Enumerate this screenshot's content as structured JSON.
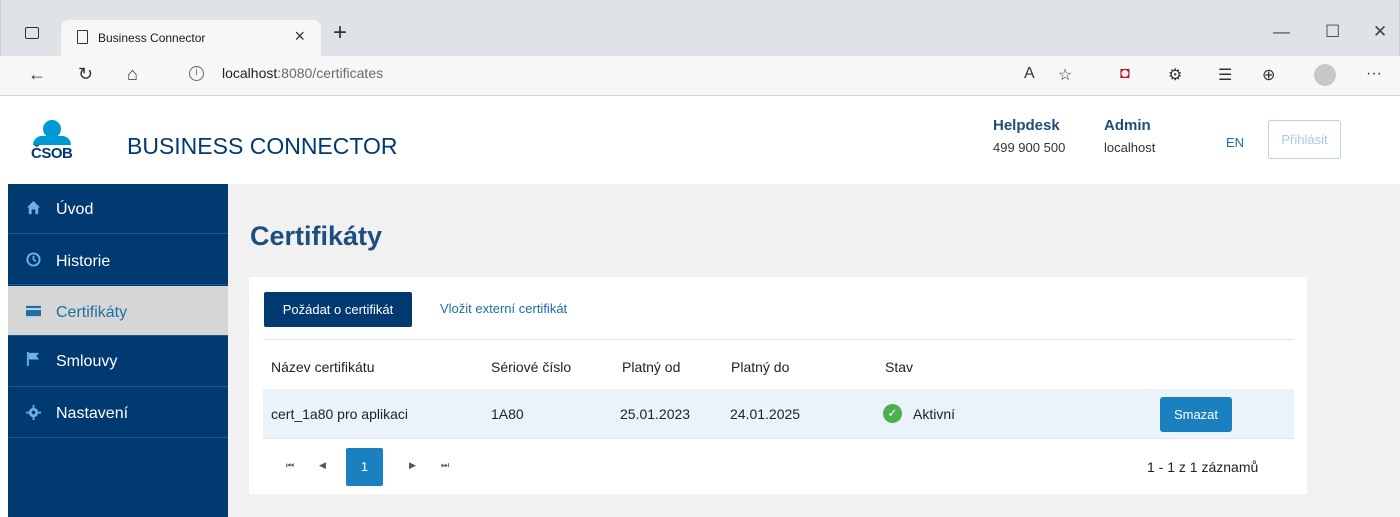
{
  "browser": {
    "tab_title": "Business Connector",
    "tab_close": "×",
    "new_tab": "+",
    "url_host": "localhost",
    "url_path": ":8080/certificates",
    "win_min": "—",
    "win_max": "☐",
    "win_close": "✕",
    "menu": "···"
  },
  "header": {
    "logo_text": "ČSOB",
    "brand": "BUSINESS CONNECTOR",
    "helpdesk_title": "Helpdesk",
    "helpdesk_phone": "499 900 500",
    "admin_title": "Admin",
    "admin_host": "localhost",
    "lang": "EN",
    "login": "Přihlásit"
  },
  "sidebar": {
    "items": [
      {
        "label": "Úvod",
        "icon": "home-icon"
      },
      {
        "label": "Historie",
        "icon": "clock-icon"
      },
      {
        "label": "Certifikáty",
        "icon": "card-icon"
      },
      {
        "label": "Smlouvy",
        "icon": "flag-icon"
      },
      {
        "label": "Nastavení",
        "icon": "gear-icon"
      }
    ],
    "active_index": 2
  },
  "main": {
    "title": "Certifikáty",
    "request_button": "Požádat o certifikát",
    "external_link": "Vložit externí certifikát",
    "columns": [
      "Název certifikátu",
      "Sériové číslo",
      "Platný od",
      "Platný do",
      "Stav"
    ],
    "rows": [
      {
        "name": "cert_1a80 pro aplikaci",
        "serial": "1A80",
        "valid_from": "25.01.2023",
        "valid_to": "24.01.2025",
        "status": "Aktivní",
        "delete": "Smazat"
      }
    ],
    "pager": {
      "first": "⏮",
      "prev": "◀",
      "current": "1",
      "next": "▶",
      "last": "⏭",
      "info": "1 - 1 z 1 záznamů"
    }
  },
  "colors": {
    "primary": "#003a70",
    "accent": "#1b80c0",
    "success": "#4caf50"
  }
}
